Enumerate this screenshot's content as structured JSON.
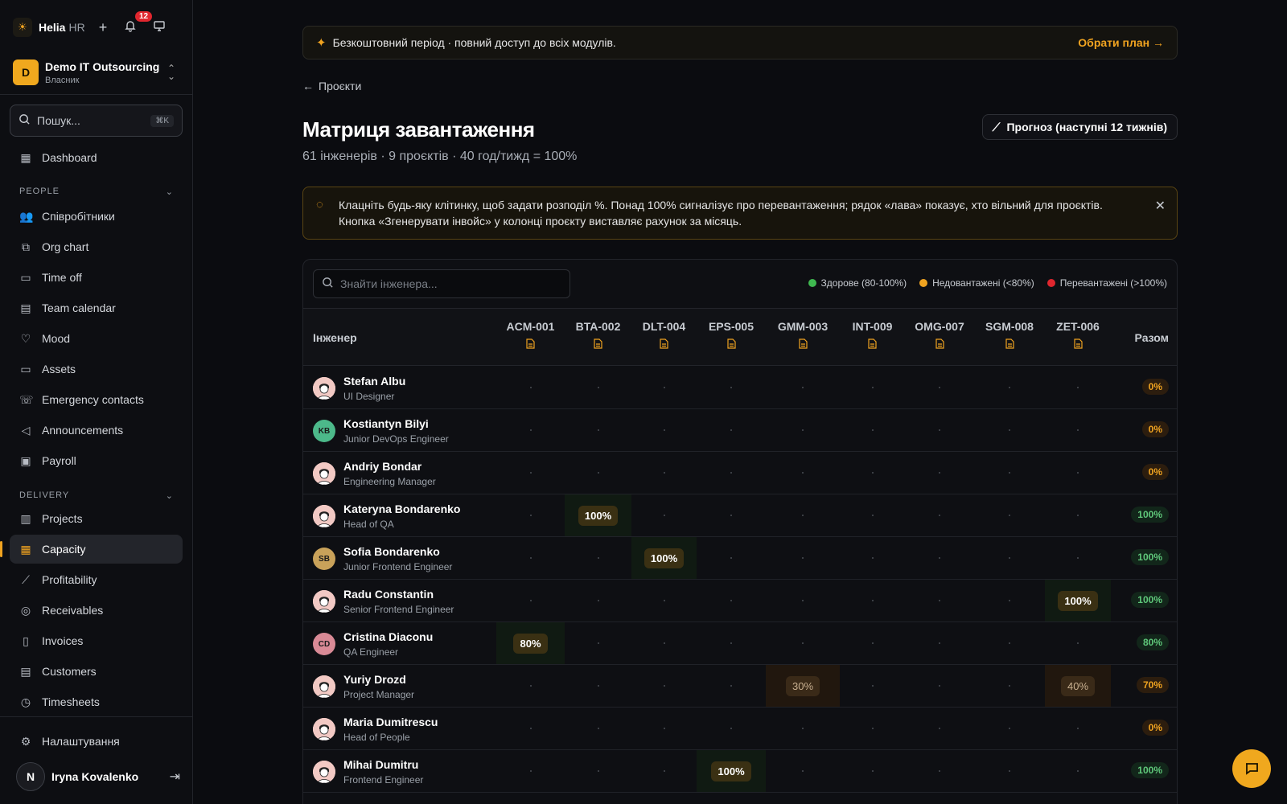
{
  "app": {
    "brand": "Helia",
    "brand_sub": "HR",
    "notifications": "12"
  },
  "org": {
    "initial": "D",
    "name": "Demo IT Outsourcing",
    "role": "Власник"
  },
  "search": {
    "placeholder": "Пошук...",
    "shortcut": "⌘K"
  },
  "nav": {
    "dashboard": "Dashboard",
    "people_title": "PEOPLE",
    "people": [
      "Співробітники",
      "Org chart",
      "Time off",
      "Team calendar",
      "Mood",
      "Assets",
      "Emergency contacts",
      "Announcements",
      "Payroll"
    ],
    "delivery_title": "DELIVERY",
    "delivery": [
      "Projects",
      "Capacity",
      "Profitability",
      "Receivables",
      "Invoices",
      "Customers",
      "Timesheets"
    ],
    "settings": "Налаштування"
  },
  "user": {
    "initial": "N",
    "name": "Iryna Kovalenko"
  },
  "trial": {
    "text": "Безкоштовний період · повний доступ до всіх модулів.",
    "cta": "Обрати план →"
  },
  "back": "Проєкти",
  "page": {
    "title": "Матриця завантаження",
    "subtitle": "61 інженерів · 9 проєктів · 40 год/тижд = 100%",
    "forecast": "Прогноз (наступні 12 тижнів)",
    "hint_line1": "Клацніть будь-яку клітинку, щоб задати розподіл %. Понад 100% сигналізує про перевантаження; рядок «лава» показує, хто вільний для проєктів.",
    "hint_line2": "Кнопка «Згенерувати інвойс» у колонці проєкту виставляє рахунок за місяць."
  },
  "matrix": {
    "search_placeholder": "Знайти інженера...",
    "legend": [
      {
        "label": "Здорове (80-100%)",
        "color": "#3fb950"
      },
      {
        "label": "Недовантажені (<80%)",
        "color": "#f0a320"
      },
      {
        "label": "Перевантажені (>100%)",
        "color": "#e0262e"
      }
    ],
    "col_engineer": "Інженер",
    "col_total": "Разом",
    "projects": [
      "ACM-001",
      "BTA-002",
      "DLT-004",
      "EPS-005",
      "GMM-003",
      "INT-009",
      "OMG-007",
      "SGM-008",
      "ZET-006"
    ],
    "rows": [
      {
        "name": "Stefan Albu",
        "role": "UI Designer",
        "avatar": "face",
        "alloc": {},
        "total": "0%"
      },
      {
        "name": "Kostiantyn Bilyi",
        "role": "Junior DevOps Engineer",
        "avatar": "KB",
        "avatar_color": "#4cb98a",
        "alloc": {},
        "total": "0%"
      },
      {
        "name": "Andriy Bondar",
        "role": "Engineering Manager",
        "avatar": "face",
        "alloc": {},
        "total": "0%"
      },
      {
        "name": "Kateryna Bondarenko",
        "role": "Head of QA",
        "avatar": "face",
        "alloc": {
          "1": "100%"
        },
        "total": "100%"
      },
      {
        "name": "Sofia Bondarenko",
        "role": "Junior Frontend Engineer",
        "avatar": "SB",
        "avatar_color": "#c9a25a",
        "alloc": {
          "2": "100%"
        },
        "total": "100%"
      },
      {
        "name": "Radu Constantin",
        "role": "Senior Frontend Engineer",
        "avatar": "face",
        "alloc": {
          "8": "100%"
        },
        "total": "100%"
      },
      {
        "name": "Cristina Diaconu",
        "role": "QA Engineer",
        "avatar": "CD",
        "avatar_color": "#d98a96",
        "alloc": {
          "0": "80%"
        },
        "total": "80%"
      },
      {
        "name": "Yuriy Drozd",
        "role": "Project Manager",
        "avatar": "face",
        "alloc": {
          "4": "30%",
          "8": "40%"
        },
        "total": "70%"
      },
      {
        "name": "Maria Dumitrescu",
        "role": "Head of People",
        "avatar": "face",
        "alloc": {},
        "total": "0%"
      },
      {
        "name": "Mihai Dumitru",
        "role": "Frontend Engineer",
        "avatar": "face",
        "alloc": {
          "3": "100%"
        },
        "total": "100%"
      }
    ]
  }
}
